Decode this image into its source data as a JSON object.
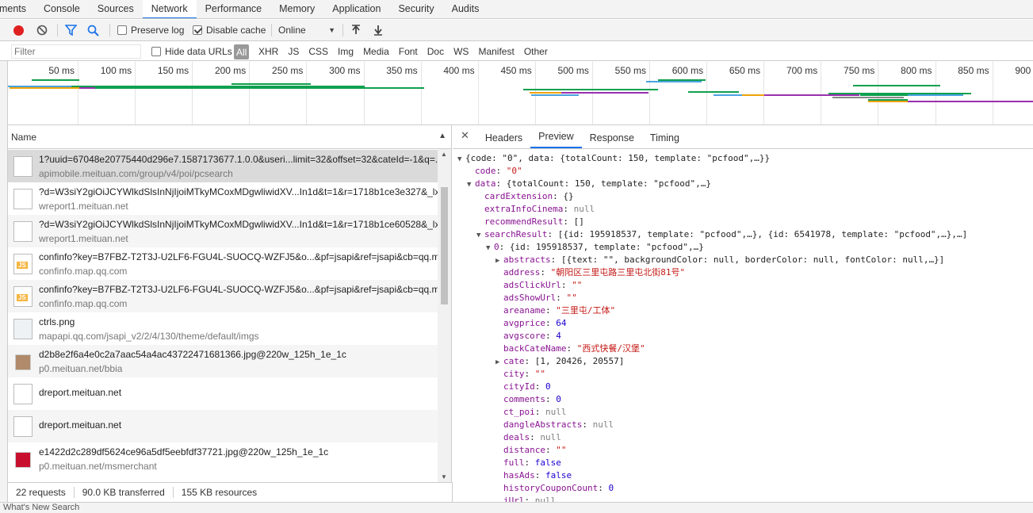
{
  "tabs": [
    {
      "label": "ements",
      "active": false
    },
    {
      "label": "Console",
      "active": false
    },
    {
      "label": "Sources",
      "active": false
    },
    {
      "label": "Network",
      "active": true
    },
    {
      "label": "Performance",
      "active": false
    },
    {
      "label": "Memory",
      "active": false
    },
    {
      "label": "Application",
      "active": false
    },
    {
      "label": "Security",
      "active": false
    },
    {
      "label": "Audits",
      "active": false
    }
  ],
  "toolbar": {
    "preserve_log": "Preserve log",
    "disable_cache": "Disable cache",
    "throttle": "Online",
    "record_icon": "record-icon",
    "clear_icon": "clear-icon",
    "filter_icon": "filter-icon",
    "search_icon": "search-icon",
    "import_icon": "import-icon",
    "export_icon": "export-icon"
  },
  "filter": {
    "placeholder": "Filter",
    "hide_data_urls": "Hide data URLs",
    "all": "All",
    "types": [
      "XHR",
      "JS",
      "CSS",
      "Img",
      "Media",
      "Font",
      "Doc",
      "WS",
      "Manifest",
      "Other"
    ]
  },
  "overview": {
    "ticks": [
      "50 ms",
      "100 ms",
      "150 ms",
      "200 ms",
      "250 ms",
      "300 ms",
      "350 ms",
      "400 ms",
      "450 ms",
      "500 ms",
      "550 ms",
      "600 ms",
      "650 ms",
      "700 ms",
      "750 ms",
      "800 ms",
      "850 ms",
      "900 ms"
    ]
  },
  "requests": {
    "column": "Name",
    "items": [
      {
        "name": "1?uuid=67048e20775440d296e7.1587173677.1.0.0&useri...limit=32&offset=32&cateId=-1&q=...",
        "domain": "apimobile.meituan.com/group/v4/poi/pcsearch",
        "icon": "document-icon"
      },
      {
        "name": "?d=W3siY2giOiJCYWlkdSlsInNjIjoiMTkyMCoxMDgwliwidXV...In1d&t=1&r=1718b1ce3e327&_lx...",
        "domain": "wreport1.meituan.net",
        "icon": "document-icon"
      },
      {
        "name": "?d=W3siY2giOiJCYWlkdSlsInNjIjoiMTkyMCoxMDgwliwidXV...In1d&t=1&r=1718b1ce60528&_lx...",
        "domain": "wreport1.meituan.net",
        "icon": "document-icon"
      },
      {
        "name": "confinfo?key=B7FBZ-T2T3J-U2LF6-FGU4L-SUOCQ-WZFJ5&o...&pf=jsapi&ref=jsapi&cb=qq.ma...",
        "domain": "confinfo.map.qq.com",
        "icon": "js-icon"
      },
      {
        "name": "confinfo?key=B7FBZ-T2T3J-U2LF6-FGU4L-SUOCQ-WZFJ5&o...&pf=jsapi&ref=jsapi&cb=qq.ma...",
        "domain": "confinfo.map.qq.com",
        "icon": "js-icon"
      },
      {
        "name": "ctrls.png",
        "domain": "mapapi.qq.com/jsapi_v2/2/4/130/theme/default/imgs",
        "icon": "image-icon"
      },
      {
        "name": "d2b8e2f6a4e0c2a7aac54a4ac43722471681366.jpg@220w_125h_1e_1c",
        "domain": "p0.meituan.net/bbia",
        "icon": "food-thumbnail-icon"
      },
      {
        "name": "dreport.meituan.net",
        "domain": "",
        "icon": "document-icon"
      },
      {
        "name": "dreport.meituan.net",
        "domain": "",
        "icon": "document-icon"
      },
      {
        "name": "e1422d2c289df5624ce96a5df5eebfdf37721.jpg@220w_125h_1e_1c",
        "domain": "p0.meituan.net/msmerchant",
        "icon": "red-thumbnail-icon"
      }
    ]
  },
  "status": {
    "requests": "22 requests",
    "transferred": "90.0 KB transferred",
    "resources": "155 KB resources"
  },
  "detail": {
    "close_icon": "close-icon",
    "tabs": [
      "Headers",
      "Preview",
      "Response",
      "Timing"
    ],
    "active_tab": "Preview",
    "tree": [
      {
        "indent": 0,
        "tri": "down",
        "k": "",
        "v": "{code: \"0\", data: {totalCount: 150, template: \"pcfood\",…}}",
        "t": "plain"
      },
      {
        "indent": 1,
        "tri": "",
        "k": "code",
        "v": "\"0\"",
        "t": "s"
      },
      {
        "indent": 1,
        "tri": "down",
        "k": "data",
        "v": "{totalCount: 150, template: \"pcfood\",…}",
        "t": "plain"
      },
      {
        "indent": 2,
        "tri": "",
        "k": "cardExtension",
        "v": "{}",
        "t": "plain"
      },
      {
        "indent": 2,
        "tri": "",
        "k": "extraInfoCinema",
        "v": "null",
        "t": "nul"
      },
      {
        "indent": 2,
        "tri": "",
        "k": "recommendResult",
        "v": "[]",
        "t": "plain"
      },
      {
        "indent": 2,
        "tri": "down",
        "k": "searchResult",
        "v": "[{id: 195918537, template: \"pcfood\",…}, {id: 6541978, template: \"pcfood\",…},…]",
        "t": "plain"
      },
      {
        "indent": 3,
        "tri": "down",
        "k": "0",
        "v": "{id: 195918537, template: \"pcfood\",…}",
        "t": "plain"
      },
      {
        "indent": 4,
        "tri": "right",
        "k": "abstracts",
        "v": "[{text: \"\", backgroundColor: null, borderColor: null, fontColor: null,…}]",
        "t": "plain"
      },
      {
        "indent": 4,
        "tri": "",
        "k": "address",
        "v": "\"朝阳区三里屯路三里屯北街81号\"",
        "t": "s"
      },
      {
        "indent": 4,
        "tri": "",
        "k": "adsClickUrl",
        "v": "\"\"",
        "t": "s"
      },
      {
        "indent": 4,
        "tri": "",
        "k": "adsShowUrl",
        "v": "\"\"",
        "t": "s"
      },
      {
        "indent": 4,
        "tri": "",
        "k": "areaname",
        "v": "\"三里屯/工体\"",
        "t": "s"
      },
      {
        "indent": 4,
        "tri": "",
        "k": "avgprice",
        "v": "64",
        "t": "num"
      },
      {
        "indent": 4,
        "tri": "",
        "k": "avgscore",
        "v": "4",
        "t": "num"
      },
      {
        "indent": 4,
        "tri": "",
        "k": "backCateName",
        "v": "\"西式快餐/汉堡\"",
        "t": "s"
      },
      {
        "indent": 4,
        "tri": "right",
        "k": "cate",
        "v": "[1, 20426, 20557]",
        "t": "plain"
      },
      {
        "indent": 4,
        "tri": "",
        "k": "city",
        "v": "\"\"",
        "t": "s"
      },
      {
        "indent": 4,
        "tri": "",
        "k": "cityId",
        "v": "0",
        "t": "num"
      },
      {
        "indent": 4,
        "tri": "",
        "k": "comments",
        "v": "0",
        "t": "num"
      },
      {
        "indent": 4,
        "tri": "",
        "k": "ct_poi",
        "v": "null",
        "t": "nul"
      },
      {
        "indent": 4,
        "tri": "",
        "k": "dangleAbstracts",
        "v": "null",
        "t": "nul"
      },
      {
        "indent": 4,
        "tri": "",
        "k": "deals",
        "v": "null",
        "t": "nul"
      },
      {
        "indent": 4,
        "tri": "",
        "k": "distance",
        "v": "\"\"",
        "t": "s"
      },
      {
        "indent": 4,
        "tri": "",
        "k": "full",
        "v": "false",
        "t": "num"
      },
      {
        "indent": 4,
        "tri": "",
        "k": "hasAds",
        "v": "false",
        "t": "num"
      },
      {
        "indent": 4,
        "tri": "",
        "k": "historyCouponCount",
        "v": "0",
        "t": "num"
      },
      {
        "indent": 4,
        "tri": "",
        "k": "iUrl",
        "v": "null",
        "t": "nul"
      }
    ]
  },
  "bottom": "What's New    Search",
  "colors": {
    "accent": "#1a73e8",
    "record": "#e02020"
  }
}
